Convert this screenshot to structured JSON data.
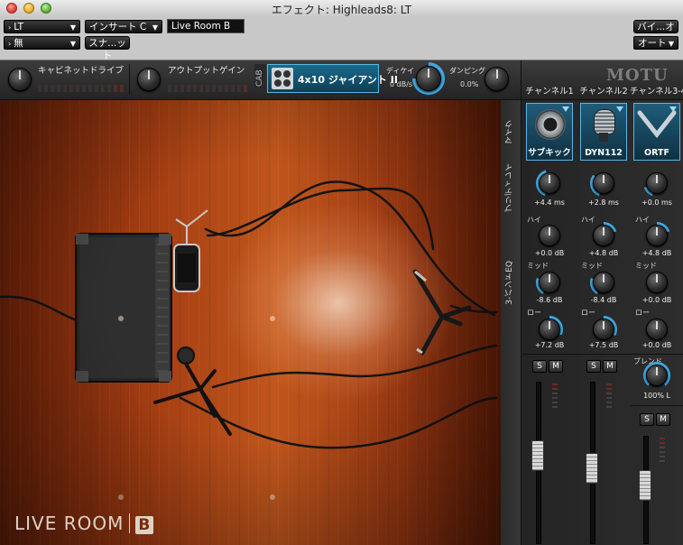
{
  "window": {
    "title": "エフェクト: Highleads8: LT"
  },
  "toolbar": {
    "track": "LT",
    "insert": "インサート C",
    "plugin_name": "Live Room B",
    "preset": "無",
    "snapshot": "スナ...ット",
    "bypass": "バイ...オフ",
    "automation": "オート"
  },
  "strip": {
    "cabinet_drive_label": "キャビネットドライブ",
    "output_gain_label": "アウトプットゲイン",
    "cab_tag": "CAB",
    "cabinet": "4x10 ジャイアント II",
    "decay_label": "ディケイ",
    "decay_value": "0 dB/s",
    "damping_label": "ダンピング",
    "damping_value": "0.0%",
    "brand": "MOTU"
  },
  "room": {
    "logo_main": "LIVE ROOM",
    "logo_letter": "B"
  },
  "mixer": {
    "side_labels": {
      "mic": "マイク",
      "predelay": "プリディレイ",
      "eq": "3-バンドEQ"
    },
    "eq_labels": {
      "high": "ハイ",
      "mid": "ミッド",
      "low": "ロー"
    },
    "blend_label": "ブレンド",
    "blend_value": "100% L",
    "solo": "S",
    "mute": "M",
    "channels": [
      {
        "header": "チャンネル1",
        "mic": "サブキック",
        "predelay": "+4.4 ms",
        "high": "+0.0 dB",
        "mid": "-8.6 dB",
        "low": "+7.2 dB",
        "fader": 0.55
      },
      {
        "header": "チャンネル2",
        "mic": "DYN112",
        "predelay": "+2.8 ms",
        "high": "+4.8 dB",
        "mid": "-8.4 dB",
        "low": "+7.5 dB",
        "fader": 0.45
      },
      {
        "header": "チャンネル3-4",
        "mic": "ORTF",
        "predelay": "+0.0 ms",
        "high": "+4.8 dB",
        "mid": "+0.0 dB",
        "low": "+0.0 dB",
        "fader": 0.55
      }
    ]
  },
  "colors": {
    "accent": "#3fa7e0",
    "mic_box_border": "#5ab6e6",
    "floor": "#b04a18",
    "panel": "#2a2a2a"
  }
}
